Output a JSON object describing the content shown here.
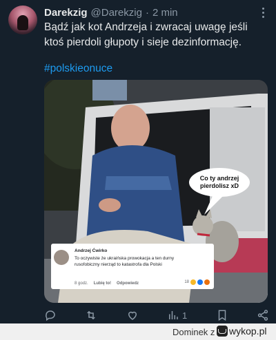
{
  "post": {
    "display_name": "Darekzig",
    "handle": "@Darekzig",
    "separator": "·",
    "time": "2 min",
    "text": "Bądź jak kot Andrzeja i zwracaj uwagę jeśli ktoś pierdoli głupoty i sieje dezinformację.",
    "hashtag": "#polskieonuce"
  },
  "meme": {
    "speech_bubble": "Co ty andrzej pierdolisz xD",
    "comment": {
      "author": "Andrzej Ćwirko",
      "text": "To oczywiste że ukraińska prowokacja a ten durny rusofobiczny nierząd to katastrofa dla Polski",
      "time": "8 godz.",
      "like_label": "Lubię to!",
      "reply_label": "Odpowiedz",
      "reaction_count": "18"
    }
  },
  "actions": {
    "reply_icon": "comment-bubble-icon",
    "retweet_icon": "retweet-icon",
    "like_icon": "heart-icon",
    "views_icon": "bar-chart-icon",
    "views_count": "1",
    "bookmark_icon": "bookmark-icon",
    "share_icon": "share-icon"
  },
  "footer": {
    "user": "Dominek",
    "separator": "z",
    "site": "wykop.pl"
  },
  "colors": {
    "background": "#15202b",
    "text": "#e7e9ea",
    "muted": "#8b98a5",
    "link": "#1d9bf0"
  }
}
